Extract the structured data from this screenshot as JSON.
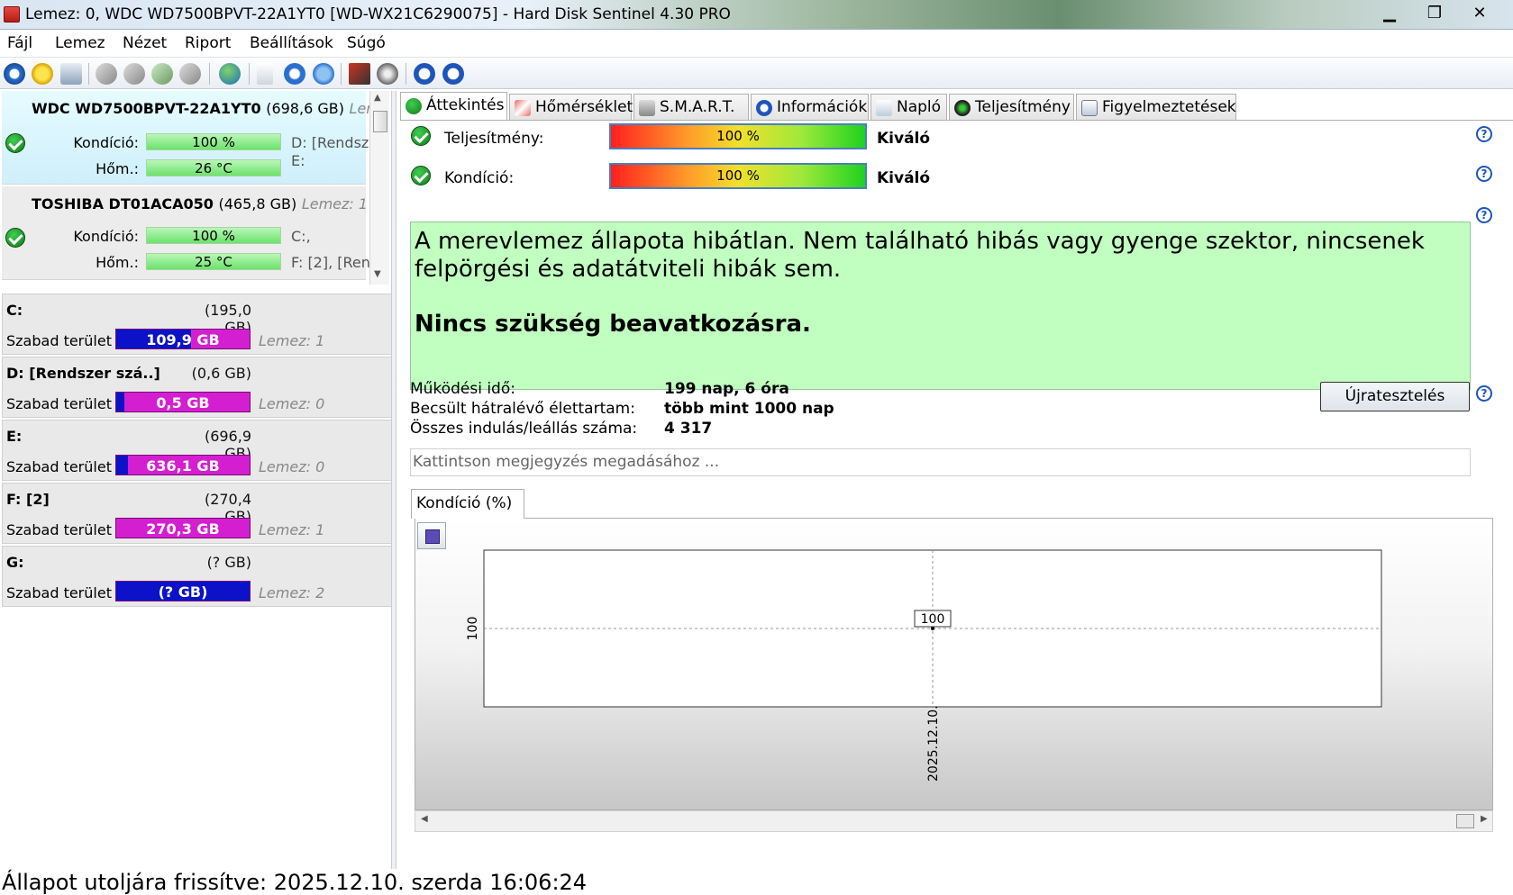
{
  "window": {
    "title": "Lemez: 0, WDC WD7500BPVT-22A1YT0 [WD-WX21C6290075]  -  Hard Disk Sentinel 4.30 PRO",
    "minimize": "▁",
    "maximize": "❐",
    "close": "✕"
  },
  "menu": [
    "Fájl",
    "Lemez",
    "Nézet",
    "Riport",
    "Beállítások",
    "Súgó"
  ],
  "toolbar": {
    "icons": [
      "refresh-icon",
      "alert-icon",
      "disk-icon",
      "sep",
      "usb-icon",
      "usb-icon",
      "usb-icon",
      "usb-icon",
      "sep",
      "globe-icon",
      "sep",
      "report-icon",
      "refresh-report-icon",
      "send-icon",
      "sep",
      "test-icon",
      "surface-icon",
      "sep",
      "help-icon",
      "info-icon"
    ]
  },
  "disks": [
    {
      "name": "WDC WD7500BPVT-22A1YT0",
      "size": "(698,6 GB)",
      "lemez": "Lem",
      "kondicio_label": "Kondíció:",
      "kondicio": "100 %",
      "hom_label": "Hőm.:",
      "hom": "26 °C",
      "parts_top": "D: [Rendsz",
      "parts_bottom": "E:",
      "selected": true
    },
    {
      "name": "TOSHIBA DT01ACA050",
      "size": "(465,8 GB)",
      "lemez": "Lemez: 1",
      "kondicio_label": "Kondíció:",
      "kondicio": "100 %",
      "hom_label": "Hőm.:",
      "hom": "25 °C",
      "parts_top": "C:,",
      "parts_bottom": "F: [2],  [Ren",
      "selected": false
    }
  ],
  "volumes": [
    {
      "name": "C:",
      "size": "(195,0 GB)",
      "free_label": "Szabad terület",
      "free": "109,9 GB",
      "free_fraction": 0.56,
      "lemez": "Lemez: 1"
    },
    {
      "name": "D: [Rendszer szá..]",
      "size": "(0,6 GB)",
      "free_label": "Szabad terület",
      "free": "0,5 GB",
      "free_fraction": 0.06,
      "lemez": "Lemez: 0"
    },
    {
      "name": "E:",
      "size": "(696,9 GB)",
      "free_label": "Szabad terület",
      "free": "636,1 GB",
      "free_fraction": 0.09,
      "lemez": "Lemez: 0"
    },
    {
      "name": "F: [2]",
      "size": "(270,4 GB)",
      "free_label": "Szabad terület",
      "free": "270,3 GB",
      "free_fraction": 0.0,
      "lemez": "Lemez: 1"
    },
    {
      "name": "G:",
      "size": "(? GB)",
      "free_label": "Szabad terület",
      "free": "(? GB)",
      "free_fraction": 1.0,
      "lemez": "Lemez: 2"
    }
  ],
  "tabs": [
    {
      "label": "Áttekintés",
      "icon": "check-icon",
      "active": true
    },
    {
      "label": "Hőmérséklet",
      "icon": "thermometer-icon",
      "active": false
    },
    {
      "label": "S.M.A.R.T.",
      "icon": "disk-icon",
      "active": false
    },
    {
      "label": "Információk",
      "icon": "info-icon",
      "active": false
    },
    {
      "label": "Napló",
      "icon": "log-icon",
      "active": false
    },
    {
      "label": "Teljesítmény",
      "icon": "performance-icon",
      "active": false
    },
    {
      "label": "Figyelmeztetések",
      "icon": "alerts-icon",
      "active": false
    }
  ],
  "overview": {
    "performance_label": "Teljesítmény:",
    "performance_value": "100 %",
    "performance_rating": "Kiváló",
    "health_label": "Kondíció:",
    "health_value": "100 %",
    "health_rating": "Kiváló",
    "status_text": "A merevlemez állapota hibátlan. Nem található hibás vagy gyenge szektor, nincsenek felpörgési és adatátviteli hibák sem.",
    "status_action": "Nincs szükség beavatkozásra.",
    "uptime_label": "Működési idő:",
    "uptime_value": "199 nap, 6 óra",
    "lifetime_label": "Becsült hátralévő élettartam:",
    "lifetime_value": "több mint 1000 nap",
    "startstop_label": "Összes indulás/leállás száma:",
    "startstop_value": "4 317",
    "retest_button": "Újratesztelés",
    "notes_placeholder": "Kattintson megjegyzés megadásához ...",
    "help_glyph": "?"
  },
  "chart_tab": "Kondíció  (%)",
  "chart_data": {
    "type": "line",
    "x": [
      "2025.12.10."
    ],
    "series": [
      {
        "values": [
          100
        ]
      }
    ],
    "ytick_labels": [
      "100"
    ],
    "xtick_labels": [
      "2025.12.10."
    ],
    "data_labels": [
      "100"
    ],
    "grid": true
  },
  "statusbar": "Állapot utoljára frissítve: 2025.12.10. szerda 16:06:24",
  "colors": {
    "status_bg": "#c0ffc0",
    "volume_used": "#d41fd0",
    "volume_free": "#0b12c8",
    "health_bar": "#6ce26a"
  }
}
